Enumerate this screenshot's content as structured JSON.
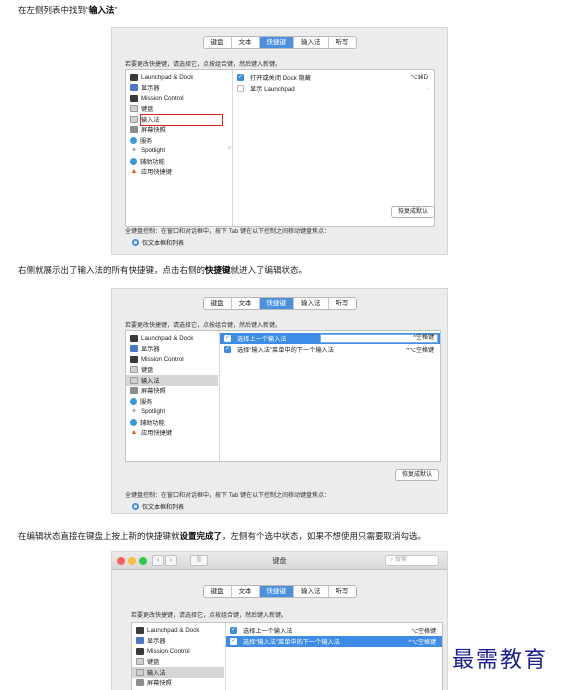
{
  "captions": {
    "c1_pre": "在左侧列表中找到“",
    "c1_bold": "输入法",
    "c1_post": "”",
    "c2_pre": "右侧就展示出了输入法的所有快捷键，点击右侧的",
    "c2_bold": "快捷键",
    "c2_post": "就进入了编辑状态。",
    "c3_pre": "在编辑状态直接在键盘上按上新的快捷键就",
    "c3_bold": "设置完成了",
    "c3_post": "，左侧有个选中状态，如果不想使用只需要取消勾选。"
  },
  "tabs": [
    "键盘",
    "文本",
    "快捷键",
    "输入法",
    "听写"
  ],
  "active_tab": "快捷键",
  "instruction": "若要更改快捷键，请选择它，点按组合键，然后键入新键。",
  "categories": [
    {
      "label": "Launchpad & Dock",
      "icon": "dock-icon"
    },
    {
      "label": "显示器",
      "icon": "display-icon"
    },
    {
      "label": "Mission Control",
      "icon": "mission-control-icon"
    },
    {
      "label": "键盘",
      "icon": "keyboard-icon"
    },
    {
      "label": "输入法",
      "icon": "input-method-icon"
    },
    {
      "label": "屏幕快照",
      "icon": "screenshot-icon"
    },
    {
      "label": "服务",
      "icon": "services-icon"
    },
    {
      "label": "Spotlight",
      "icon": "spotlight-icon"
    },
    {
      "label": "辅助功能",
      "icon": "accessibility-icon"
    },
    {
      "label": "应用快捷键",
      "icon": "app-shortcuts-icon"
    }
  ],
  "shot1": {
    "rows": [
      {
        "label": "打开或关闭 Dock 隐藏",
        "shortcut": "⌥⌘D",
        "checked": true
      },
      {
        "label": "显示 Launchpad",
        "shortcut": "-",
        "checked": false
      }
    ]
  },
  "shot2": {
    "rows": [
      {
        "label": "选择上一个输入法",
        "shortcut": "^空格键",
        "checked": true
      },
      {
        "label": "选择“输入法”菜单中的下一个输入法",
        "shortcut": "^⌥空格键",
        "checked": true
      }
    ]
  },
  "shot3": {
    "rows": [
      {
        "label": "选择上一个输入法",
        "shortcut": "⌥空格键",
        "checked": true
      },
      {
        "label": "选择“输入法”菜单中的下一个输入法",
        "shortcut": "^⌥空格键",
        "checked": true
      }
    ]
  },
  "restore_default": "恢复成默认",
  "full_keyboard_access": "全键盘控制：在窗口和对话框中，按下 Tab 键在以下控制之间移动键盘焦点：",
  "radio_option": "仅文本框和列表",
  "window": {
    "title": "键盘",
    "search_placeholder": "搜索",
    "back": "‹",
    "forward": "›",
    "grid": "⠿"
  },
  "watermark": "最需教育",
  "colors": {
    "accent": "#3d8ce6",
    "highlight_box": "#e02020",
    "watermark": "#1b1f8f"
  }
}
